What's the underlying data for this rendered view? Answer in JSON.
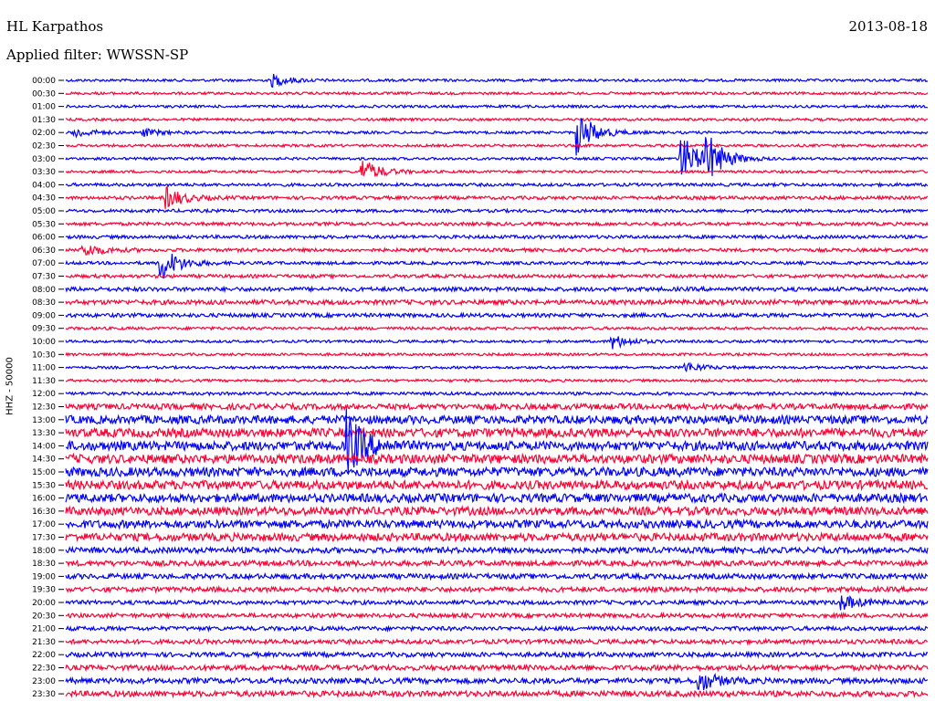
{
  "header": {
    "station": "HL Karpathos",
    "date": "2013-08-18",
    "filter": "Applied filter: WWSSN-SP",
    "channel": "HHZ - 50000"
  },
  "colors": {
    "trace_a": "#0000ff",
    "trace_b": "#ff0033"
  },
  "chart_data": {
    "type": "line",
    "title": "",
    "ylabel": "HHZ - 50000",
    "y_tick_labels": [
      "00:00",
      "00:30",
      "01:00",
      "01:30",
      "02:00",
      "02:30",
      "03:00",
      "03:30",
      "04:00",
      "04:30",
      "05:00",
      "05:30",
      "06:00",
      "06:30",
      "07:00",
      "07:30",
      "08:00",
      "08:30",
      "09:00",
      "09:30",
      "10:00",
      "10:30",
      "11:00",
      "11:30",
      "12:00",
      "12:30",
      "13:00",
      "13:30",
      "14:00",
      "14:30",
      "15:00",
      "15:30",
      "16:00",
      "16:30",
      "17:00",
      "17:30",
      "18:00",
      "18:30",
      "19:00",
      "19:30",
      "20:00",
      "20:30",
      "21:00",
      "21:30",
      "22:00",
      "22:30",
      "23:00",
      "23:30"
    ],
    "trace_colors_alternate": [
      "#0000ff",
      "#ff0033"
    ],
    "x_range_minutes": [
      0,
      30
    ],
    "relative_noise_level_per_trace": [
      1,
      1,
      1,
      1,
      1,
      1,
      1,
      1,
      1.2,
      1.3,
      1.2,
      1.3,
      1.3,
      1.3,
      1.2,
      1.3,
      1.6,
      1.8,
      1.5,
      1.1,
      1,
      1,
      1,
      1,
      1.2,
      2.2,
      3.2,
      3.4,
      3.5,
      3.5,
      3.5,
      3.4,
      3.3,
      3.2,
      3.1,
      3,
      2.2,
      2.1,
      2,
      1.9,
      1.6,
      1.6,
      1.6,
      1.7,
      1.8,
      2,
      2.1,
      2.2
    ],
    "events": [
      {
        "trace": 0,
        "minute": 7.2,
        "amplitude": 1.6
      },
      {
        "trace": 4,
        "minute": 0.3,
        "amplitude": 1.4
      },
      {
        "trace": 4,
        "minute": 2.7,
        "amplitude": 1.0
      },
      {
        "trace": 4,
        "minute": 17.8,
        "amplitude": 6.0
      },
      {
        "trace": 6,
        "minute": 21.4,
        "amplitude": 7.0
      },
      {
        "trace": 6,
        "minute": 22.3,
        "amplitude": 6.0
      },
      {
        "trace": 7,
        "minute": 10.3,
        "amplitude": 3.5
      },
      {
        "trace": 9,
        "minute": 3.5,
        "amplitude": 3.0
      },
      {
        "trace": 13,
        "minute": 0.6,
        "amplitude": 2.0
      },
      {
        "trace": 14,
        "minute": 3.3,
        "amplitude": 5.0
      },
      {
        "trace": 20,
        "minute": 19.0,
        "amplitude": 2.0
      },
      {
        "trace": 22,
        "minute": 21.5,
        "amplitude": 1.5
      },
      {
        "trace": 28,
        "minute": 9.8,
        "amplitude": 9.0
      },
      {
        "trace": 40,
        "minute": 27.0,
        "amplitude": 2.0
      },
      {
        "trace": 46,
        "minute": 22.0,
        "amplitude": 3.0
      }
    ]
  }
}
